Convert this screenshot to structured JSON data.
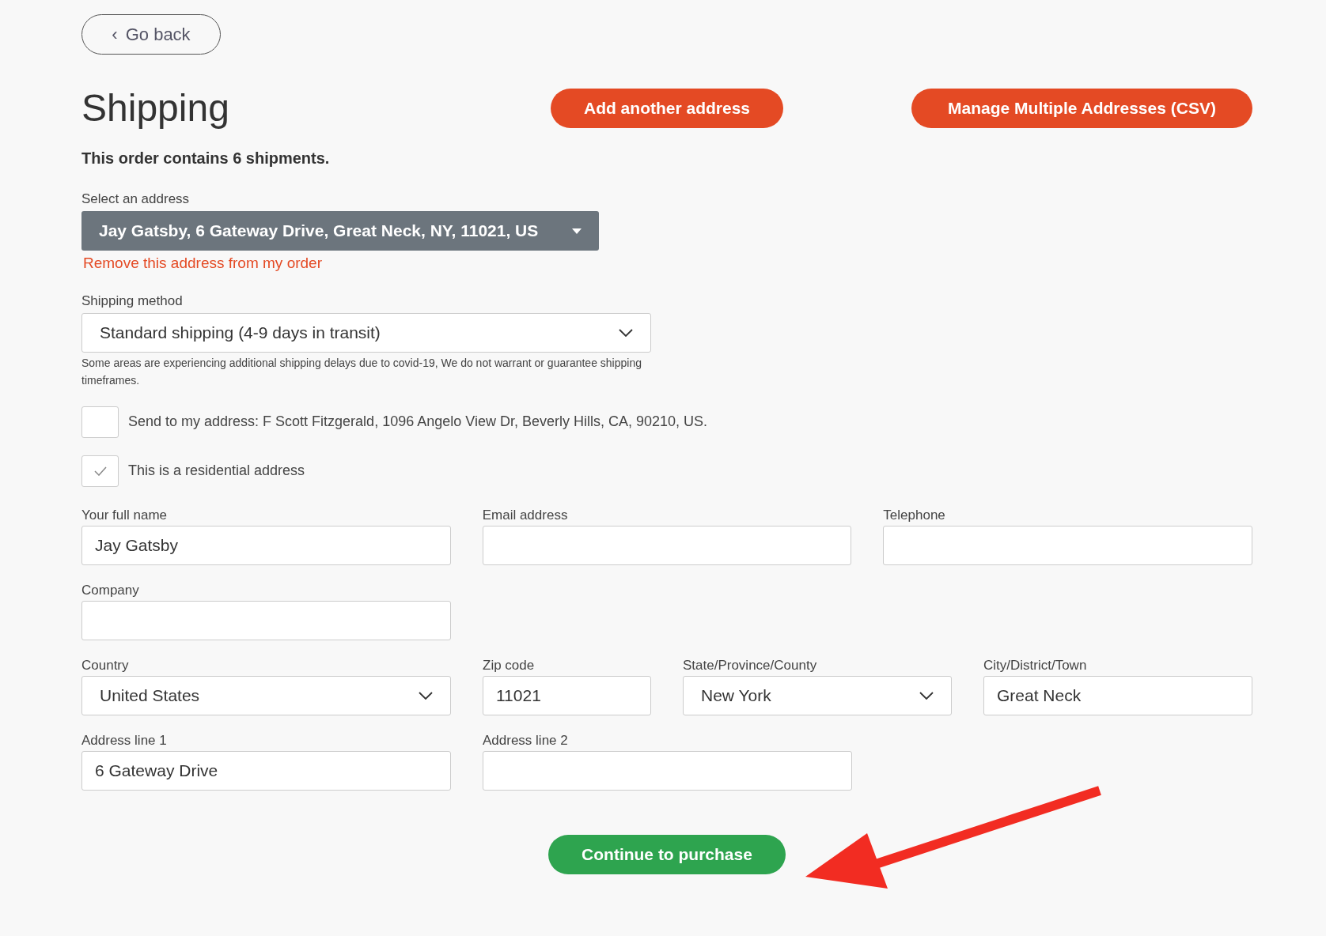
{
  "back_button": {
    "icon": "‹",
    "label": "Go back"
  },
  "title": "Shipping",
  "header_buttons": [
    "Add another address",
    "Manage Multiple Addresses (CSV)"
  ],
  "summary": "This order contains 6 shipments.",
  "address_select": {
    "label": "Select an address",
    "value": "Jay Gatsby, 6 Gateway Drive, Great Neck, NY, 11021, US"
  },
  "remove_link": "Remove this address from my order",
  "shipping_method": {
    "label": "Shipping method",
    "value": "Standard shipping (4-9 days in transit)",
    "note": "Some areas are experiencing additional shipping delays due to covid-19, We do not warrant or guarantee shipping timeframes."
  },
  "checkboxes": [
    {
      "label": "Send to my address: F Scott Fitzgerald, 1096 Angelo View Dr, Beverly Hills, CA, 90210, US.",
      "checked": false
    },
    {
      "label": "This is a residential address",
      "checked": true
    }
  ],
  "form_rows": [
    [
      {
        "label": "Your full name",
        "kind": "text",
        "value": "Jay Gatsby"
      },
      {
        "label": "Email address",
        "kind": "text"
      },
      {
        "label": "Telephone",
        "kind": "text"
      }
    ],
    [
      {
        "label": "Company",
        "kind": "text"
      }
    ],
    [
      {
        "label": "Country",
        "kind": "select",
        "value": "United States"
      },
      {
        "label": "Zip code",
        "kind": "text",
        "value": "11021"
      },
      {
        "label": "State/Province/County",
        "kind": "select",
        "value": "New York"
      },
      {
        "label": "City/District/Town",
        "kind": "text",
        "value": "Great Neck"
      }
    ],
    [
      {
        "label": "Address line 1",
        "kind": "text",
        "value": "6 Gateway Drive"
      },
      {
        "label": "Address line 2",
        "kind": "text"
      }
    ]
  ],
  "submit_button": "Continue to purchase"
}
